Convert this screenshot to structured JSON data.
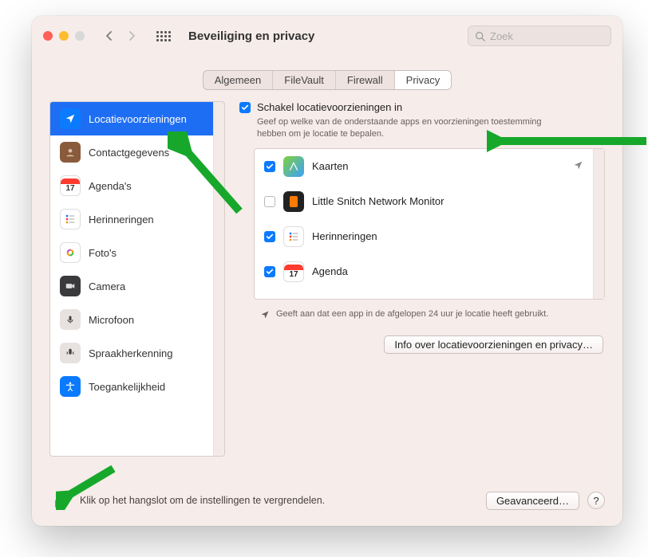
{
  "window": {
    "title": "Beveiliging en privacy"
  },
  "search": {
    "placeholder": "Zoek"
  },
  "tabs": [
    "Algemeen",
    "FileVault",
    "Firewall",
    "Privacy"
  ],
  "tabs_active_index": 3,
  "sidebar": {
    "items": [
      {
        "label": "Locatievoorzieningen",
        "icon": "location",
        "selected": true
      },
      {
        "label": "Contactgegevens",
        "icon": "contacts",
        "selected": false
      },
      {
        "label": "Agenda's",
        "icon": "calendar",
        "selected": false
      },
      {
        "label": "Herinneringen",
        "icon": "reminders",
        "selected": false
      },
      {
        "label": "Foto's",
        "icon": "photos",
        "selected": false
      },
      {
        "label": "Camera",
        "icon": "camera",
        "selected": false
      },
      {
        "label": "Microfoon",
        "icon": "mic",
        "selected": false
      },
      {
        "label": "Spraakherkenning",
        "icon": "speech",
        "selected": false
      },
      {
        "label": "Toegankelijkheid",
        "icon": "access",
        "selected": false
      }
    ]
  },
  "detail": {
    "enable_label": "Schakel locatievoorzieningen in",
    "enable_checked": true,
    "hint": "Geef op welke van de onderstaande apps en voorzieningen toestemming hebben om je locatie te bepalen.",
    "apps": [
      {
        "label": "Kaarten",
        "icon": "maps",
        "checked": true,
        "recent": true
      },
      {
        "label": "Little Snitch Network Monitor",
        "icon": "snitch",
        "checked": false,
        "recent": false
      },
      {
        "label": "Herinneringen",
        "icon": "reminders",
        "checked": true,
        "recent": false
      },
      {
        "label": "Agenda",
        "icon": "calendar",
        "checked": true,
        "recent": false
      }
    ],
    "recent_note": "Geeft aan dat een app in de afgelopen 24 uur je locatie heeft gebruikt.",
    "info_button": "Info over locatievoorzieningen en privacy…"
  },
  "footer": {
    "lock_text": "Klik op het hangslot om de instellingen te vergrendelen.",
    "advanced": "Geavanceerd…",
    "help": "?"
  },
  "calendar_day": "17"
}
